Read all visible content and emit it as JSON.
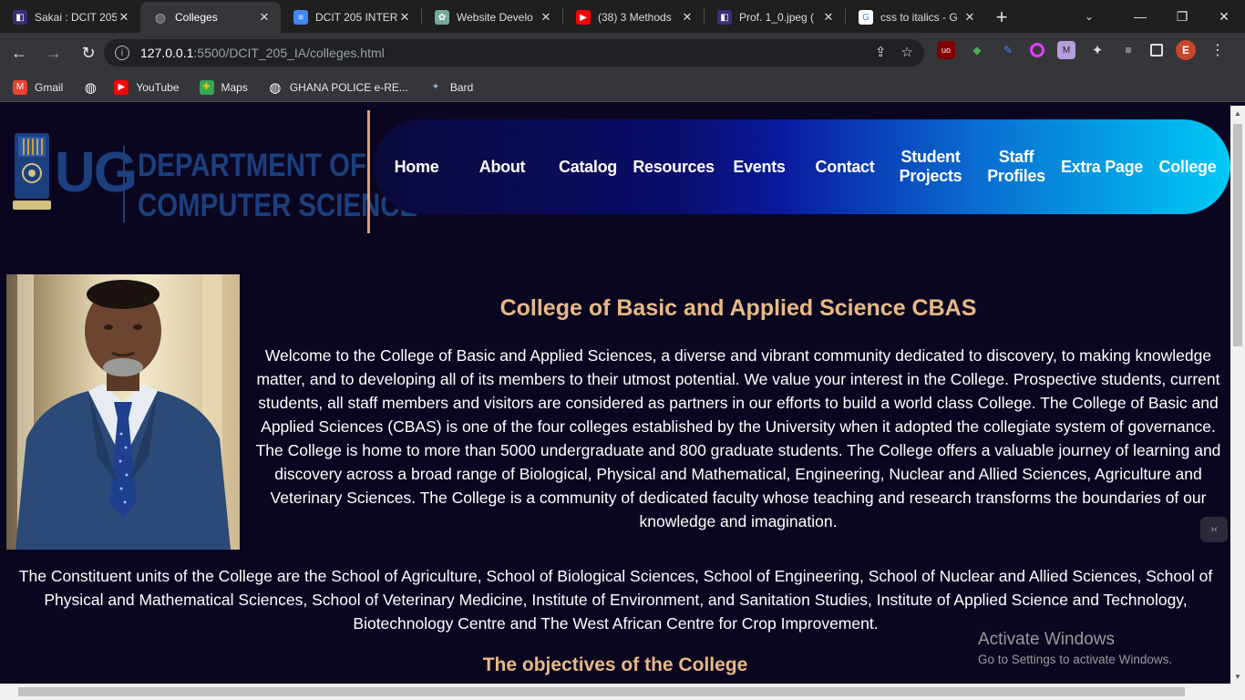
{
  "browser": {
    "tabs": [
      {
        "title": "Sakai : DCIT 205",
        "icon": "sakai-icon",
        "color": "#3c2d7a"
      },
      {
        "title": "Colleges",
        "icon": "globe-icon",
        "color": "#888888",
        "active": true
      },
      {
        "title": "DCIT 205 INTER",
        "icon": "docs-icon",
        "color": "#4285f4"
      },
      {
        "title": "Website Develo",
        "icon": "chatgpt-icon",
        "color": "#74aa9c"
      },
      {
        "title": "(38) 3 Methods",
        "icon": "youtube-icon",
        "color": "#ff0000"
      },
      {
        "title": "Prof. 1_0.jpeg (",
        "icon": "sakai-icon",
        "color": "#3c2d7a"
      },
      {
        "title": "css to italics - G",
        "icon": "google-icon",
        "color": "#ffffff"
      }
    ],
    "new_tab": "+",
    "url_host": "127.0.0.1",
    "url_path": ":5500/DCIT_205_IA/colleges.html",
    "bookmarks": [
      {
        "label": "Gmail",
        "icon": "gmail-icon"
      },
      {
        "label": "",
        "icon": "globe-icon"
      },
      {
        "label": "YouTube",
        "icon": "youtube-icon"
      },
      {
        "label": "Maps",
        "icon": "maps-icon"
      },
      {
        "label": "GHANA POLICE e-RE...",
        "icon": "globe-icon"
      },
      {
        "label": "Bard",
        "icon": "bard-icon"
      }
    ],
    "profile_initial": "E"
  },
  "logo": {
    "ug": "UG",
    "line1": "DEPARTMENT OF",
    "line2": "COMPUTER SCIENCE"
  },
  "nav": {
    "items": [
      "Home",
      "About",
      "Catalog",
      "Resources",
      "Events",
      "Contact",
      "Student Projects",
      "Staff Profiles",
      "Extra Page",
      "College"
    ]
  },
  "main": {
    "title": "College of Basic and Applied Science CBAS",
    "intro": "Welcome to the College of Basic and Applied Sciences, a diverse and vibrant community dedicated to discovery, to making knowledge matter, and to developing all of its members to their utmost potential. We value your interest in the College. Prospective students, current students, all staff members and visitors are considered as partners in our efforts to build a world class College. The College of Basic and Applied Sciences (CBAS) is one of the four colleges established by the University when it adopted the collegiate system of governance. The College is home to more than 5000 undergraduate and 800 graduate students. The College offers a valuable journey of learning and discovery across a broad range of Biological, Physical and Mathematical, Engineering, Nuclear and Allied Sciences, Agriculture and Veterinary Sciences. The College is a community of dedicated faculty whose teaching and research transforms the boundaries of our knowledge and imagination.",
    "units": "The Constituent units of the College are the School of Agriculture, School of Biological Sciences, School of Engineering, School of Nuclear and Allied Sciences, School of Physical and Mathematical Sciences, School of Veterinary Medicine, Institute of Environment, and Sanitation Studies, Institute of Applied Science and Technology, Biotechnology Centre and The West African Centre for Crop Improvement.",
    "objectives_heading": "The objectives of the College"
  },
  "watermark": {
    "line1": "Activate Windows",
    "line2": "Go to Settings to activate Windows."
  },
  "colors": {
    "accent_gold": "#e7b986",
    "page_bg": "#0b0620",
    "logo_blue": "#1c3f7d"
  }
}
